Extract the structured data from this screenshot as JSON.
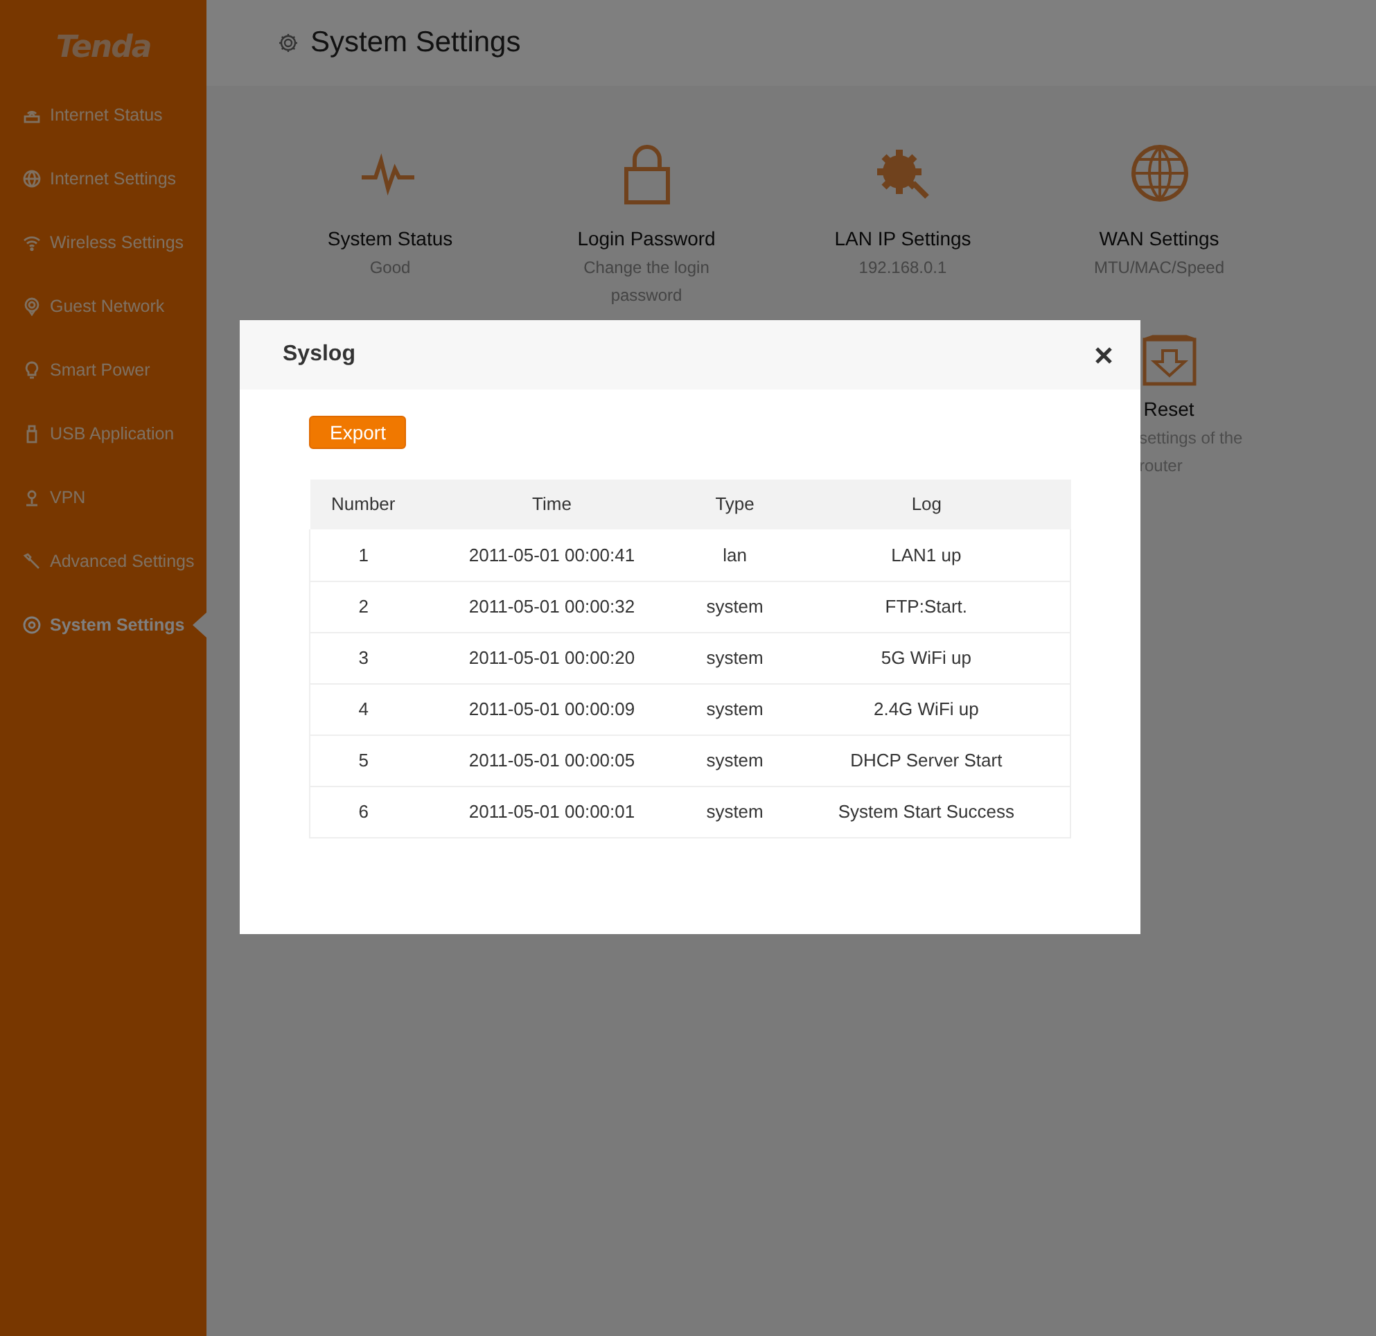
{
  "sidebar": {
    "logo": "Tenda",
    "items": [
      {
        "label": "Internet Status",
        "selected": false
      },
      {
        "label": "Internet Settings",
        "selected": false
      },
      {
        "label": "Wireless Settings",
        "selected": false
      },
      {
        "label": "Guest Network",
        "selected": false
      },
      {
        "label": "Smart Power",
        "selected": false
      },
      {
        "label": "USB Application",
        "selected": false
      },
      {
        "label": "VPN",
        "selected": false
      },
      {
        "label": "Advanced Settings",
        "selected": false
      },
      {
        "label": "System Settings",
        "selected": true
      }
    ]
  },
  "header": {
    "title": "System Settings"
  },
  "cards": [
    {
      "title": "System Status",
      "subtitle": "Good"
    },
    {
      "title": "Login Password",
      "subtitle": "Change the login password"
    },
    {
      "title": "LAN IP Settings",
      "subtitle": "192.168.0.1"
    },
    {
      "title": "WAN Settings",
      "subtitle": "MTU/MAC/Speed"
    }
  ],
  "partial_card": {
    "title": "Reset",
    "subtitle_lines": [
      "settings of the",
      "router"
    ]
  },
  "modal": {
    "title": "Syslog",
    "export_button": "Export",
    "table": {
      "columns": [
        "Number",
        "Time",
        "Type",
        "Log"
      ],
      "rows": [
        [
          "1",
          "2011-05-01 00:00:41",
          "lan",
          "LAN1 up"
        ],
        [
          "2",
          "2011-05-01 00:00:32",
          "system",
          "FTP:Start."
        ],
        [
          "3",
          "2011-05-01 00:00:20",
          "system",
          "5G WiFi up"
        ],
        [
          "4",
          "2011-05-01 00:00:09",
          "system",
          "2.4G WiFi up"
        ],
        [
          "5",
          "2011-05-01 00:00:05",
          "system",
          "DHCP Server Start"
        ],
        [
          "6",
          "2011-05-01 00:00:01",
          "system",
          "System Start Success"
        ]
      ]
    }
  }
}
